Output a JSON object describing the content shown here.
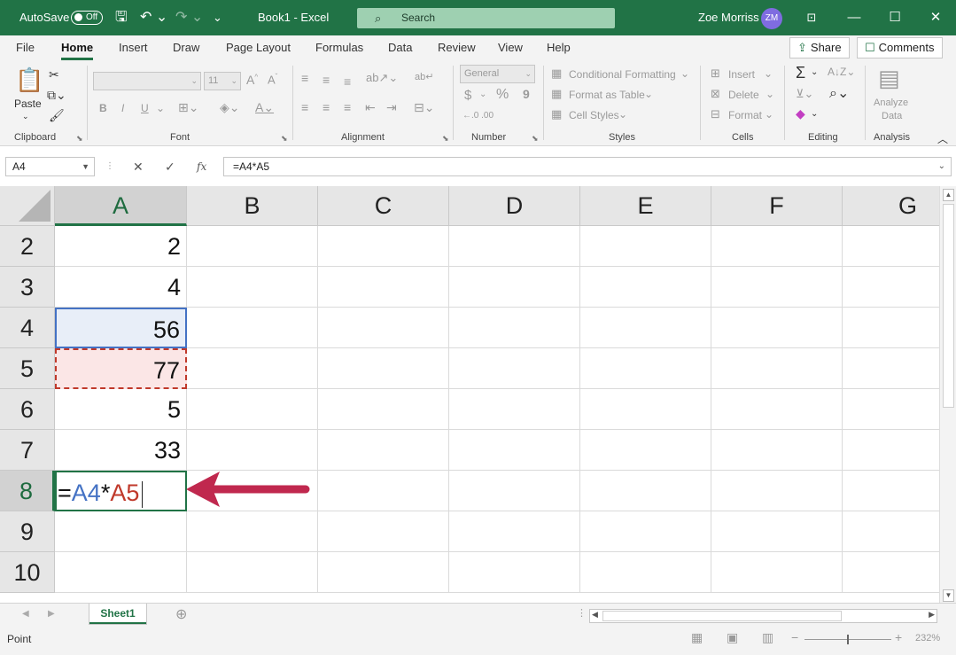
{
  "titlebar": {
    "autosave_label": "AutoSave",
    "autosave_state": "Off",
    "document_title": "Book1  -  Excel",
    "search_placeholder": "Search",
    "user_name": "Zoe Morriss",
    "user_initials": "ZM"
  },
  "menu": {
    "tabs": [
      "File",
      "Home",
      "Insert",
      "Draw",
      "Page Layout",
      "Formulas",
      "Data",
      "Review",
      "View",
      "Help"
    ],
    "active_tab": "Home",
    "share_label": "Share",
    "comments_label": "Comments"
  },
  "ribbon": {
    "clipboard": {
      "paste_label": "Paste",
      "group_label": "Clipboard"
    },
    "font": {
      "size": "11",
      "bold": "B",
      "italic": "I",
      "underline": "U",
      "group_label": "Font"
    },
    "alignment": {
      "group_label": "Alignment"
    },
    "number": {
      "format": "General",
      "currency": "$",
      "percent": "%",
      "comma": "9",
      "decimals": "←.0 .00",
      "group_label": "Number"
    },
    "styles": {
      "conditional_formatting": "Conditional Formatting",
      "format_as_table": "Format as Table",
      "cell_styles": "Cell Styles",
      "group_label": "Styles"
    },
    "cells": {
      "insert": "Insert",
      "delete": "Delete",
      "format": "Format",
      "group_label": "Cells"
    },
    "editing": {
      "group_label": "Editing"
    },
    "analysis": {
      "analyze_data_line1": "Analyze",
      "analyze_data_line2": "Data",
      "group_label": "Analysis"
    }
  },
  "formula_bar": {
    "name_box": "A4",
    "fx_label": "fx",
    "formula": "=A4*A5"
  },
  "grid": {
    "columns": [
      "A",
      "B",
      "C",
      "D",
      "E",
      "F",
      "G"
    ],
    "rows": [
      "2",
      "3",
      "4",
      "5",
      "6",
      "7",
      "8",
      "9",
      "10"
    ],
    "values_col_a": [
      "2",
      "4",
      "56",
      "77",
      "5",
      "33",
      "",
      "",
      ""
    ],
    "editing_cell": {
      "eq": "=",
      "ref1": "A4",
      "op": "*",
      "ref2": "A5"
    }
  },
  "sheets": {
    "active": "Sheet1"
  },
  "statusbar": {
    "mode": "Point",
    "zoom": "232%"
  },
  "colors": {
    "accent": "#217346",
    "ref1": "#4472c4",
    "ref2": "#c0392b",
    "arrow": "#c0284e"
  }
}
